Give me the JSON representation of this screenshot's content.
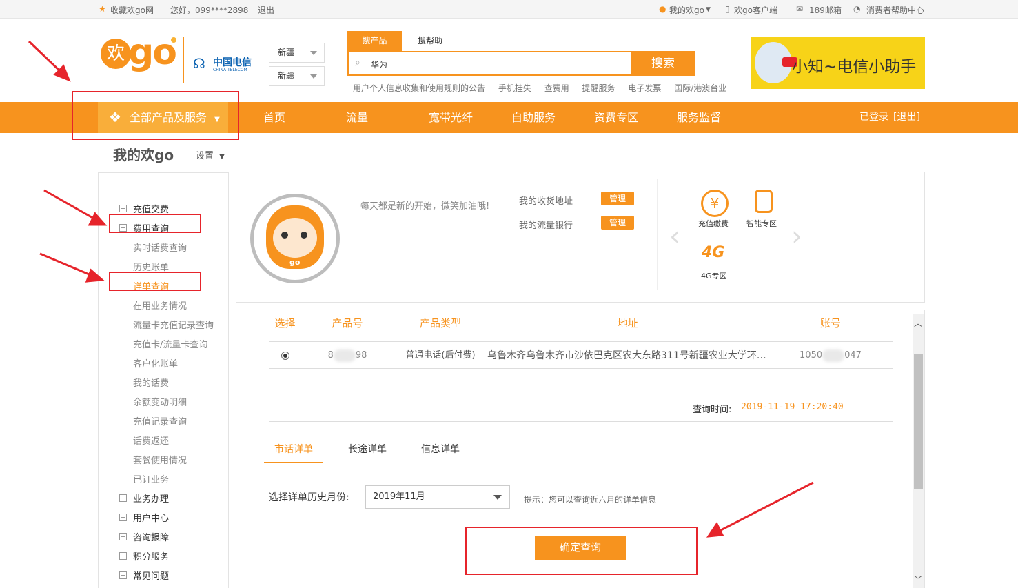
{
  "topbar": {
    "favorite": "收藏欢go网",
    "greeting": "您好，099****2898",
    "logout": "退出",
    "my_huango": "我的欢go",
    "client": "欢go客户端",
    "mail": "189邮箱",
    "help_center": "消费者帮助中心"
  },
  "header": {
    "logo_text_a": "欢",
    "logo_text_b": "go",
    "carrier_name": "中国电信",
    "carrier_en": "CHINA TELECOM",
    "region1": "新疆",
    "region2": "新疆",
    "search_tab_active": "搜产品",
    "search_tab_other": "搜帮助",
    "search_value": "华为",
    "search_button": "搜索",
    "quicklinks": [
      "用户个人信息收集和使用规则的公告",
      "手机挂失",
      "查费用",
      "提醒服务",
      "电子发票",
      "国际/港澳台业"
    ],
    "helper_text": "小知~电信小助手"
  },
  "nav": {
    "all_label": "全部产品及服务",
    "items": [
      "首页",
      "流量",
      "宽带光纤",
      "自助服务",
      "资费专区",
      "服务监督"
    ],
    "logged_in": "已登录",
    "logout": "[退出]"
  },
  "page_title": "我的欢go",
  "settings": "设置",
  "sidebar": {
    "items": [
      {
        "label": "充值交费",
        "type": "top"
      },
      {
        "label": "费用查询",
        "type": "top-open"
      },
      {
        "label": "实时话费查询",
        "type": "sub"
      },
      {
        "label": "历史账单",
        "type": "sub"
      },
      {
        "label": "详单查询",
        "type": "sub-active"
      },
      {
        "label": "在用业务情况",
        "type": "sub"
      },
      {
        "label": "流量卡充值记录查询",
        "type": "sub"
      },
      {
        "label": "充值卡/流量卡查询",
        "type": "sub"
      },
      {
        "label": "客户化账单",
        "type": "sub"
      },
      {
        "label": "我的话费",
        "type": "sub"
      },
      {
        "label": "余额变动明细",
        "type": "sub"
      },
      {
        "label": "充值记录查询",
        "type": "sub"
      },
      {
        "label": "话费返还",
        "type": "sub"
      },
      {
        "label": "套餐使用情况",
        "type": "sub"
      },
      {
        "label": "已订业务",
        "type": "sub"
      },
      {
        "label": "业务办理",
        "type": "top"
      },
      {
        "label": "用户中心",
        "type": "top"
      },
      {
        "label": "咨询报障",
        "type": "top"
      },
      {
        "label": "积分服务",
        "type": "top"
      },
      {
        "label": "常见问题",
        "type": "top"
      }
    ]
  },
  "profile": {
    "motto": "每天都是新的开始，微笑加油哦!",
    "address_label": "我的收货地址",
    "traffic_bank_label": "我的流量银行",
    "manage": "管理",
    "shortcuts": [
      {
        "label": "充值缴费",
        "icon": "yuan-icon"
      },
      {
        "label": "智能专区",
        "icon": "smart-icon"
      },
      {
        "label": "4G专区",
        "icon": "4g-icon"
      }
    ],
    "avatar_badge": "go"
  },
  "table": {
    "headers": [
      "选择",
      "产品号",
      "产品类型",
      "地址",
      "账号"
    ],
    "row": {
      "product_no_a": "8",
      "product_no_b": "98",
      "product_type": "普通电话(后付费)",
      "address": "乌鲁木齐乌鲁木齐市沙依巴克区农大东路311号新疆农业大学环…",
      "account_a": "1050",
      "account_b": "047"
    },
    "query_time_label": "查询时间:",
    "query_time_value": "2019-11-19 17:20:40"
  },
  "detail_tabs": [
    "市话详单",
    "长途详单",
    "信息详单"
  ],
  "month_label": "选择详单历史月份:",
  "month_value": "2019年11月",
  "hint": "提示：您可以查询近六月的详单信息",
  "confirm_button": "确定查询",
  "colors": {
    "accent": "#f7931e",
    "annotation_red": "#e6242b"
  }
}
